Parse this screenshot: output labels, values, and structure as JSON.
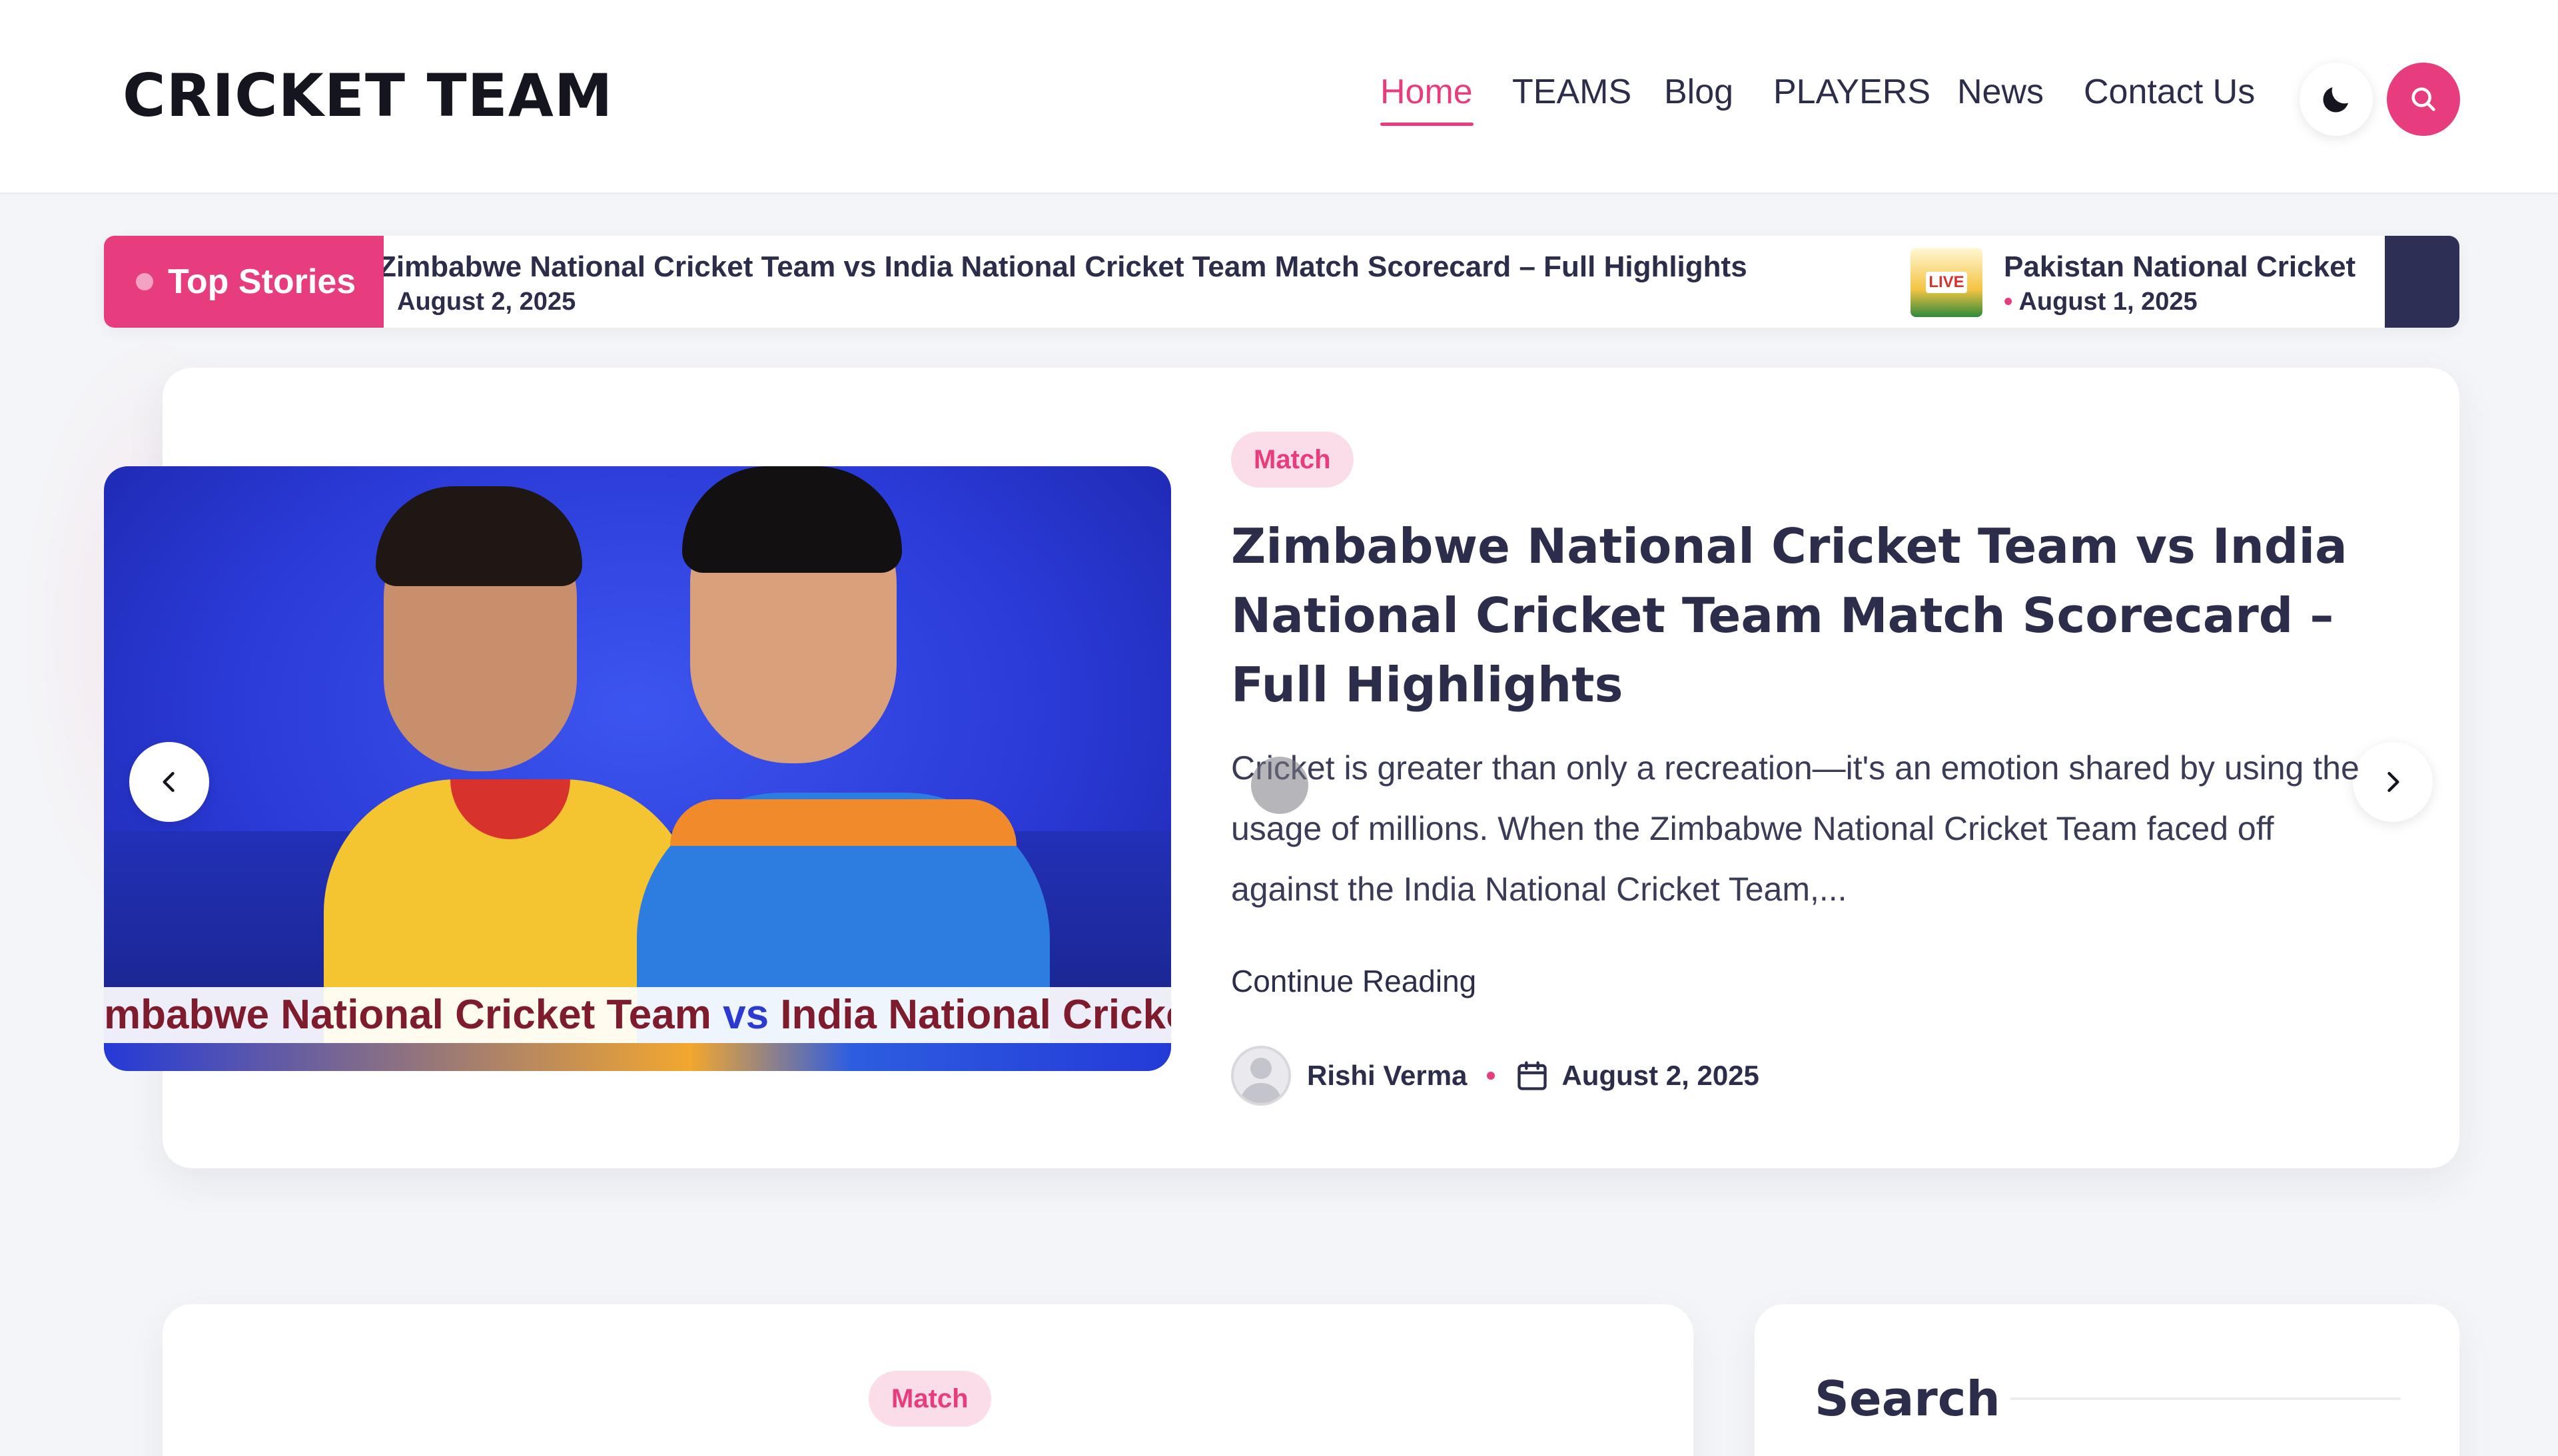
{
  "site": {
    "title": "CRICKET TEAM"
  },
  "nav": {
    "items": [
      {
        "label": "Home",
        "active": true
      },
      {
        "label": "TEAMS"
      },
      {
        "label": "Blog"
      },
      {
        "label": "PLAYERS"
      },
      {
        "label": "News"
      },
      {
        "label": "Contact Us"
      }
    ]
  },
  "header_icons": {
    "theme_toggle": "moon-icon",
    "search": "search-icon"
  },
  "ticker": {
    "label": "Top Stories",
    "items": [
      {
        "title": "Zimbabwe National Cricket Team vs India National Cricket Team Match Scorecard – Full Highlights",
        "date": "August 2, 2025"
      },
      {
        "title": "Pakistan National Cricket",
        "date": "August 1, 2025",
        "thumb_text": "LIVE"
      }
    ]
  },
  "hero": {
    "category": "Match",
    "title": "Zimbabwe National Cricket Team vs India National Cricket Team Match Scorecard – Full Highlights",
    "excerpt": "Cricket is greater than only a recreation—it's an emotion shared by using the usage of millions. When the Zimbabwe National Cricket Team faced off against the India National Cricket Team,...",
    "continue_label": "Continue Reading",
    "author": "Rishi Verma",
    "date": "August 2, 2025",
    "image_banner": {
      "part1": "mbabwe National Cricket Team ",
      "vs": "vs",
      "part2": " India National Cricket Team"
    }
  },
  "second_post": {
    "category": "Match"
  },
  "sidebar": {
    "search_title": "Search"
  },
  "colors": {
    "accent": "#e73c7e",
    "text": "#2b2d4a",
    "background": "#f4f5f8"
  }
}
